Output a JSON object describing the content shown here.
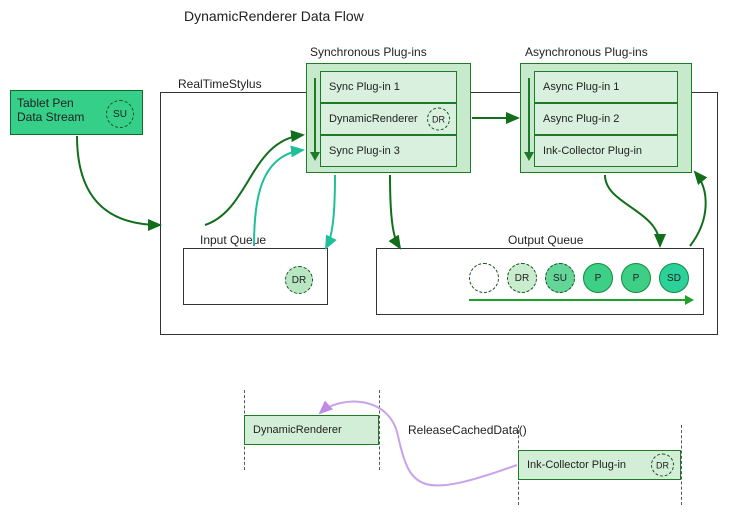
{
  "title": "DynamicRenderer Data Flow",
  "pen_box": {
    "line1": "Tablet Pen",
    "line2": "Data Stream",
    "badge": "SU"
  },
  "rts_label": "RealTimeStylus",
  "sync": {
    "label": "Synchronous Plug-ins",
    "items": [
      "Sync Plug-in 1",
      "DynamicRenderer",
      "Sync Plug-in 3"
    ],
    "dr_badge": "DR"
  },
  "async": {
    "label": "Asynchronous Plug-ins",
    "items": [
      "Async Plug-in 1",
      "Async Plug-in 2",
      "Ink-Collector Plug-in"
    ]
  },
  "input_queue": {
    "label": "Input Queue",
    "badge": "DR"
  },
  "output_queue": {
    "label": "Output Queue",
    "circles": [
      {
        "text": "",
        "fill": "#ffffff",
        "dashed": true
      },
      {
        "text": "DR",
        "fill": "#c9eccf",
        "dashed": true
      },
      {
        "text": "SU",
        "fill": "#63d596",
        "dashed": true
      },
      {
        "text": "P",
        "fill": "#3dcf86",
        "dashed": false
      },
      {
        "text": "P",
        "fill": "#3dcf86",
        "dashed": false
      },
      {
        "text": "SD",
        "fill": "#2bd09a",
        "dashed": false
      }
    ]
  },
  "lower": {
    "dr_label": "DynamicRenderer",
    "ink_label": "Ink-Collector Plug-in",
    "ink_badge": "DR",
    "rcd_label": "ReleaseCachedData()"
  }
}
